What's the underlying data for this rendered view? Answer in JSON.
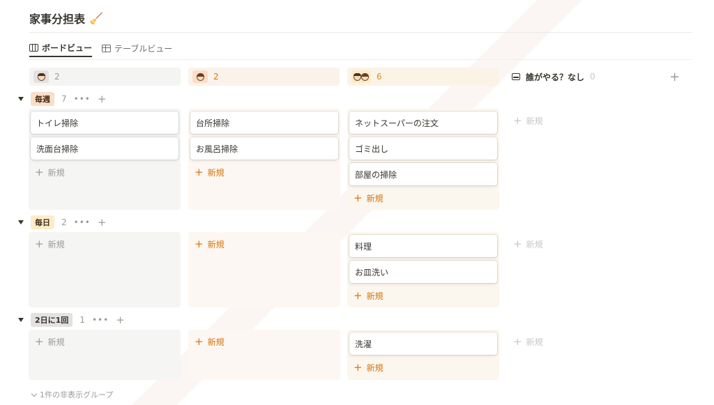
{
  "page": {
    "title": "家事分担表",
    "title_icon": "🧹"
  },
  "views": [
    {
      "label": "ボードビュー",
      "icon": "board-icon",
      "active": true
    },
    {
      "label": "テーブルビュー",
      "icon": "table-icon",
      "active": false
    }
  ],
  "columns": [
    {
      "count": "2",
      "avatar": "boy"
    },
    {
      "count": "2",
      "avatar": "girl"
    },
    {
      "count": "6",
      "avatar": "both"
    },
    {
      "label": "誰がやる？なし",
      "count": "0"
    }
  ],
  "groups": [
    {
      "name": "毎週",
      "count": "7",
      "cells": [
        [
          "トイレ掃除",
          "洗面台掃除"
        ],
        [
          "台所掃除",
          "お風呂掃除"
        ],
        [
          "ネットスーパーの注文",
          "ゴミ出し",
          "部屋の掃除"
        ],
        []
      ]
    },
    {
      "name": "毎日",
      "count": "2",
      "cells": [
        [],
        [],
        [
          "料理",
          "お皿洗い"
        ],
        []
      ]
    },
    {
      "name": "2日に1回",
      "count": "1",
      "cells": [
        [],
        [],
        [
          "洗濯"
        ],
        []
      ]
    }
  ],
  "new_label": "新規",
  "plus_symbol": "+",
  "more_symbol": "•••",
  "hidden_groups_label": "1件の非表示グループ",
  "colors": {
    "person1_bg": "#f5f5f4",
    "person2_bg": "#fcf7f2",
    "both_bg": "#fbf7ee",
    "accent_orange": "#d9730d"
  }
}
